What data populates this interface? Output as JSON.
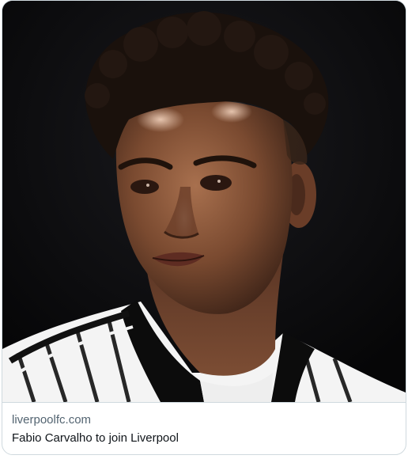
{
  "link_card": {
    "domain": "liverpoolfc.com",
    "title": "Fabio Carvalho to join Liverpool",
    "image_icon": "photo-of-footballer",
    "colors": {
      "border": "#cfd9de",
      "domain_text": "#536471",
      "title_text": "#0f1419",
      "photo_background": "#0d0d0f"
    }
  }
}
